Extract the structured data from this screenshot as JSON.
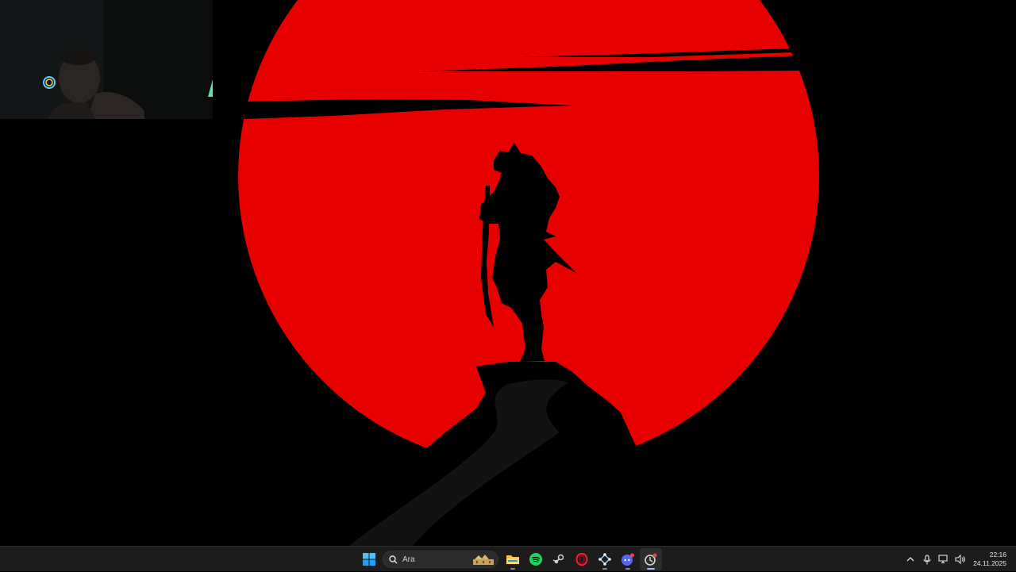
{
  "taskbar": {
    "search": {
      "icon": "search-icon",
      "placeholder": "Ara"
    },
    "apps": [
      {
        "name": "start",
        "icon": "windows-logo-icon"
      },
      {
        "name": "file-explorer",
        "icon": "folder-icon"
      },
      {
        "name": "spotify",
        "icon": "spotify-icon"
      },
      {
        "name": "steam",
        "icon": "steam-icon"
      },
      {
        "name": "opera",
        "icon": "opera-icon"
      },
      {
        "name": "network-app",
        "icon": "network-icon"
      },
      {
        "name": "discord",
        "icon": "discord-icon"
      },
      {
        "name": "active-app",
        "icon": "app-icon",
        "active": true
      }
    ],
    "tray": {
      "icons": [
        "chevron-up-icon",
        "microphone-icon",
        "network-icon",
        "speaker-icon"
      ],
      "time": "22:16",
      "date": "24.11.2025"
    }
  },
  "colors": {
    "sun": "#e60000",
    "silhouette": "#000000",
    "taskbar_bg": "#1c1c1c",
    "active_indicator": "#9fb9ff"
  }
}
